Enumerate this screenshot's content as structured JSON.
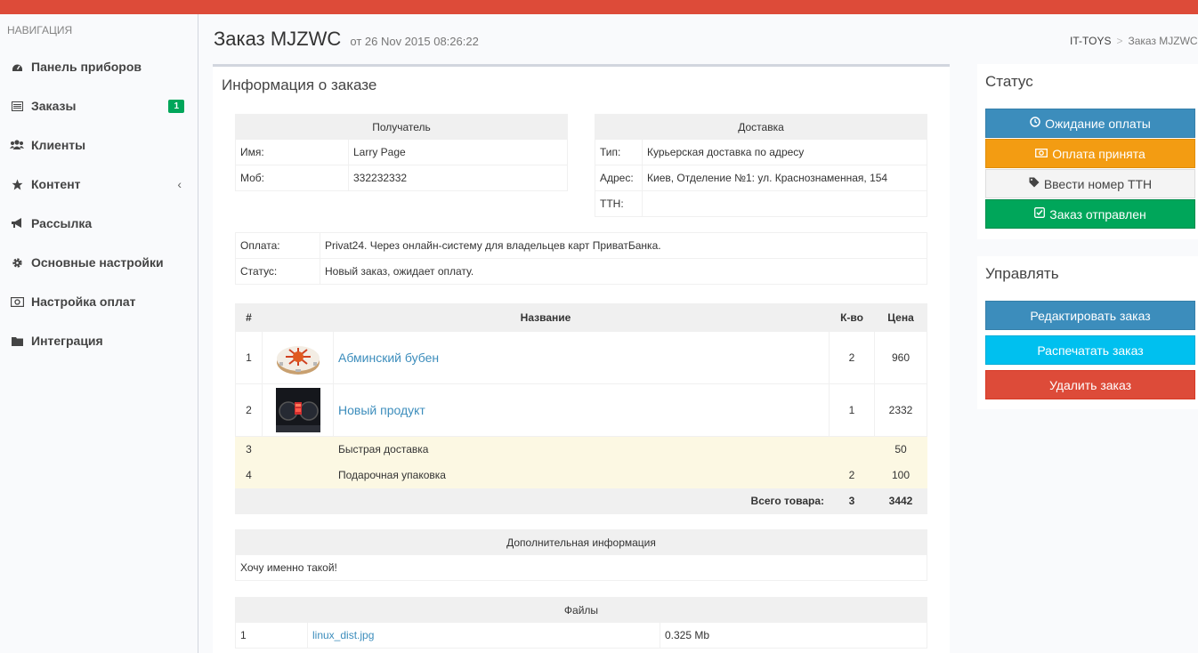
{
  "sidebar": {
    "header": "НАВИГАЦИЯ",
    "items": [
      {
        "label": "Панель приборов",
        "icon": "dashboard-icon"
      },
      {
        "label": "Заказы",
        "icon": "list-icon",
        "badge": "1"
      },
      {
        "label": "Клиенты",
        "icon": "users-icon"
      },
      {
        "label": "Контент",
        "icon": "star-icon",
        "chevron": "‹"
      },
      {
        "label": "Рассылка",
        "icon": "bullhorn-icon"
      },
      {
        "label": "Основные настройки",
        "icon": "gear-icon"
      },
      {
        "label": "Настройка оплат",
        "icon": "money-icon"
      },
      {
        "label": "Интеграция",
        "icon": "folder-icon"
      }
    ]
  },
  "header": {
    "title": "Заказ MJZWC",
    "subtitle": "от 26 Nov 2015 08:26:22",
    "breadcrumb_home": "IT-TOYS",
    "breadcrumb_separator": ">",
    "breadcrumb_current": "Заказ MJZWC"
  },
  "order_info": {
    "title": "Информация о заказе",
    "recipient": {
      "header": "Получатель",
      "name_label": "Имя:",
      "name_value": "Larry Page",
      "phone_label": "Моб:",
      "phone_value": "332232332"
    },
    "delivery": {
      "header": "Доставка",
      "type_label": "Тип:",
      "type_value": "Курьерская доставка по адресу",
      "address_label": "Адрес:",
      "address_value": "Киев, Отделение №1: ул. Краснознаменная, 154",
      "ttn_label": "ТТН:",
      "ttn_value": ""
    },
    "payment": {
      "payment_label": "Оплата:",
      "payment_value": "Privat24. Через онлайн-систему для владельцев карт ПриватБанка.",
      "status_label": "Статус:",
      "status_value": "Новый заказ, ожидает оплату."
    },
    "items_table": {
      "headers": {
        "num": "#",
        "name": "Название",
        "qty": "К-во",
        "price": "Цена"
      },
      "products": [
        {
          "num": "1",
          "name": "Абминский бубен",
          "qty": "2",
          "price": "960",
          "image": "tambourine-image"
        },
        {
          "num": "2",
          "name": "Новый продукт",
          "qty": "1",
          "price": "2332",
          "image": "car-dashboard-image"
        }
      ],
      "services": [
        {
          "num": "3",
          "name": "Быстрая доставка",
          "qty": "",
          "price": "50"
        },
        {
          "num": "4",
          "name": "Подарочная упаковка",
          "qty": "2",
          "price": "100"
        }
      ],
      "total_label": "Всего товара:",
      "total_qty": "3",
      "total_price": "3442"
    },
    "additional": {
      "header": "Дополнительная информация",
      "text": "Хочу именно такой!"
    },
    "files": {
      "header": "Файлы",
      "rows": [
        {
          "num": "1",
          "name": "linux_dist.jpg",
          "size": "0.325 Mb"
        }
      ]
    }
  },
  "status_box": {
    "title": "Статус",
    "buttons": [
      {
        "label": "Ожидание оплаты",
        "icon": "clock-icon",
        "color": "#3c8dbc"
      },
      {
        "label": "Оплата принята",
        "icon": "money-icon",
        "color": "#f39c12"
      },
      {
        "label": "Ввести номер ТТН",
        "icon": "tag-icon",
        "color": "#f4f4f4"
      },
      {
        "label": "Заказ отправлен",
        "icon": "check-square-icon",
        "color": "#00a65a"
      }
    ]
  },
  "manage_box": {
    "title": "Управлять",
    "buttons": [
      {
        "label": "Редактировать заказ",
        "color": "#3c8dbc"
      },
      {
        "label": "Распечатать заказ",
        "color": "#00c0ef"
      },
      {
        "label": "Удалить заказ",
        "color": "#dd4b39"
      }
    ]
  },
  "colors": {
    "topbar": "#dd4b39",
    "link": "#3c8dbc",
    "badge": "#00a65a",
    "service_row": "#fcf8e3"
  }
}
